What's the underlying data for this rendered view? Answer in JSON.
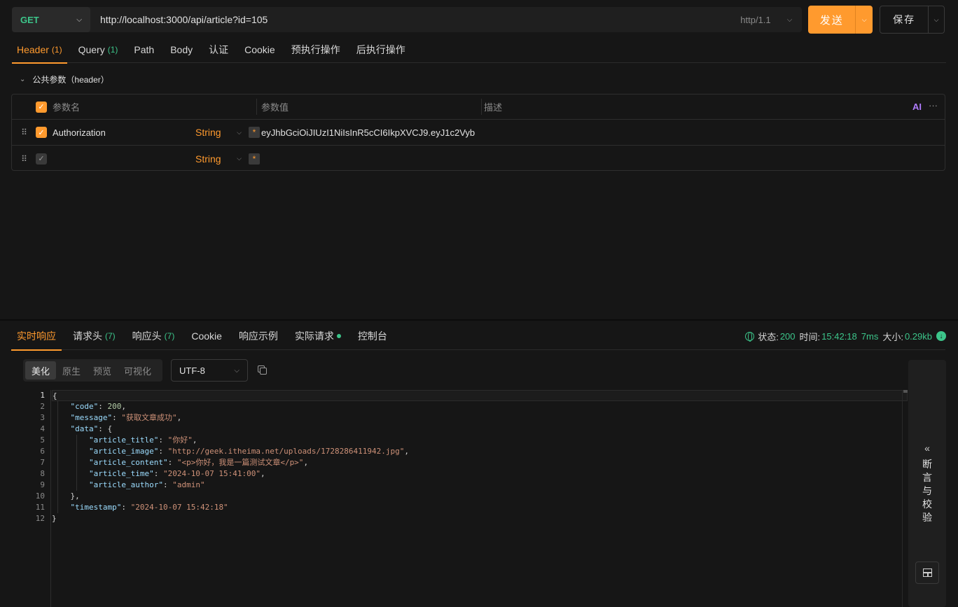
{
  "request": {
    "method": "GET",
    "url": "http://localhost:3000/api/article?id=105",
    "protocol": "http/1.1",
    "send_label": "发送",
    "save_label": "保存"
  },
  "request_tabs": [
    {
      "label": "Header",
      "count": "(1)"
    },
    {
      "label": "Query",
      "count": "(1)"
    },
    {
      "label": "Path",
      "count": ""
    },
    {
      "label": "Body",
      "count": ""
    },
    {
      "label": "认证",
      "count": ""
    },
    {
      "label": "Cookie",
      "count": ""
    },
    {
      "label": "预执行操作",
      "count": ""
    },
    {
      "label": "后执行操作",
      "count": ""
    }
  ],
  "group_label": "公共参数（header）",
  "params": {
    "headers": {
      "name": "参数名",
      "value": "参数值",
      "desc": "描述",
      "ai": "AI"
    },
    "rows": [
      {
        "name": "Authorization",
        "type": "String",
        "required_mark": "*",
        "value": "eyJhbGciOiJIUzI1NiIsInR5cCI6IkpXVCJ9.eyJ1c2Vyb"
      },
      {
        "name": "",
        "type": "String",
        "required_mark": "*",
        "value": ""
      }
    ]
  },
  "response_tabs": [
    {
      "label": "实时响应",
      "count": ""
    },
    {
      "label": "请求头",
      "count": "(7)"
    },
    {
      "label": "响应头",
      "count": "(7)"
    },
    {
      "label": "Cookie",
      "count": ""
    },
    {
      "label": "响应示例",
      "count": ""
    },
    {
      "label": "实际请求",
      "count": ""
    },
    {
      "label": "控制台",
      "count": ""
    }
  ],
  "status": {
    "status_label": "状态:",
    "status_value": "200",
    "time_label": "时间:",
    "time_value": "15:42:18",
    "duration": "7ms",
    "size_label": "大小:",
    "size_value": "0.29kb"
  },
  "format_tabs": [
    "美化",
    "原生",
    "预览",
    "可视化"
  ],
  "encoding": "UTF-8",
  "response_json": {
    "code": "200",
    "message": "\"获取文章成功\"",
    "article_title": "\"你好\"",
    "article_image": "\"http://geek.itheima.net/uploads/1728286411942.jpg\"",
    "article_content": "\"<p>你好，我是一篇测试文章</p>\"",
    "article_time": "\"2024-10-07 15:41:00\"",
    "article_author": "\"admin\"",
    "timestamp": "\"2024-10-07 15:42:18\""
  },
  "line_numbers": [
    "1",
    "2",
    "3",
    "4",
    "5",
    "6",
    "7",
    "8",
    "9",
    "10",
    "11",
    "12"
  ],
  "side_panel": {
    "arrow": "«",
    "label": "断言与校验"
  }
}
